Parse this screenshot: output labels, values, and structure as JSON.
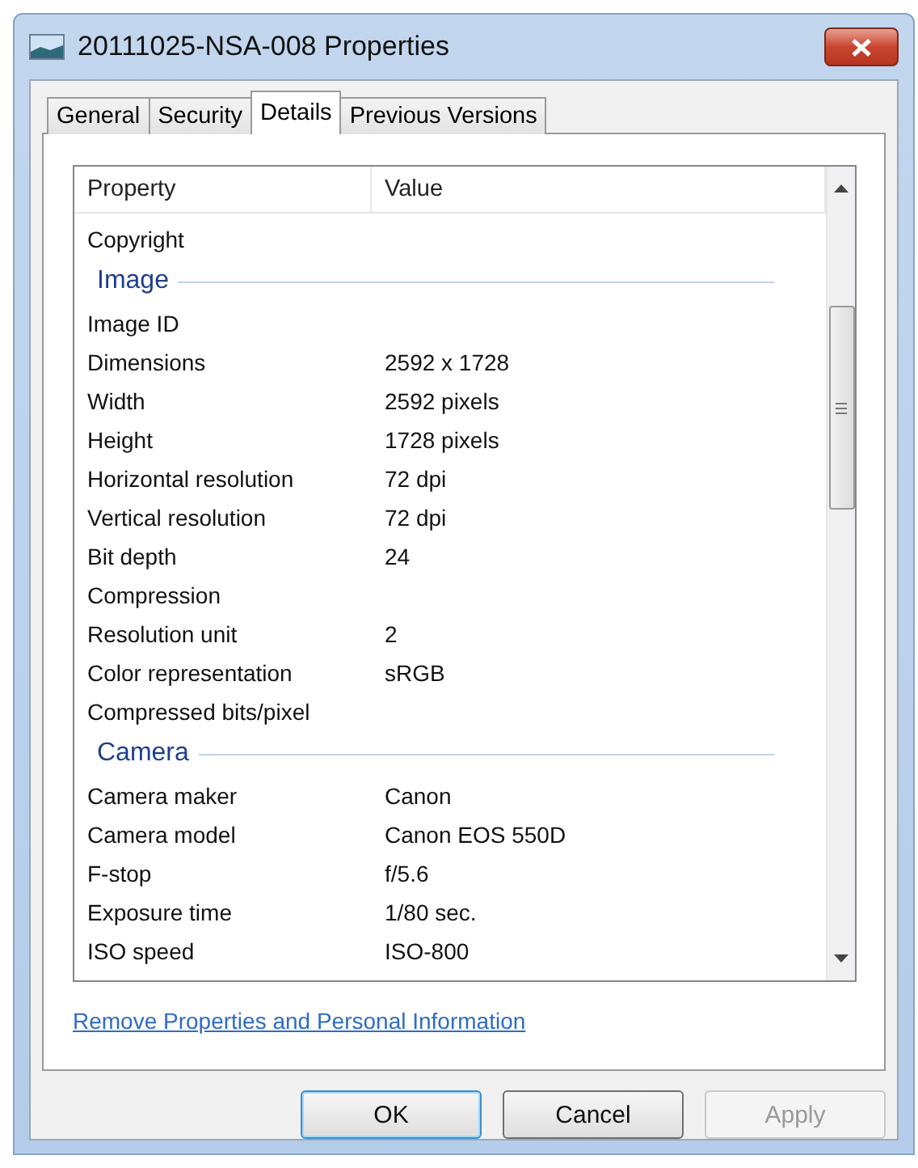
{
  "window": {
    "title": "20111025-NSA-008 Properties"
  },
  "tabs": [
    {
      "label": "General",
      "selected": false
    },
    {
      "label": "Security",
      "selected": false
    },
    {
      "label": "Details",
      "selected": true
    },
    {
      "label": "Previous Versions",
      "selected": false
    }
  ],
  "table": {
    "columns": [
      "Property",
      "Value"
    ],
    "rows": [
      {
        "kind": "row",
        "property": "Copyright"
      },
      {
        "kind": "group",
        "property": "Image"
      },
      {
        "kind": "row",
        "property": "Image ID"
      },
      {
        "kind": "row",
        "property": "Dimensions",
        "value": "2592 x 1728"
      },
      {
        "kind": "row",
        "property": "Width",
        "value": "2592 pixels"
      },
      {
        "kind": "row",
        "property": "Height",
        "value": "1728 pixels"
      },
      {
        "kind": "row",
        "property": "Horizontal resolution",
        "value": "72 dpi"
      },
      {
        "kind": "row",
        "property": "Vertical resolution",
        "value": "72 dpi"
      },
      {
        "kind": "row",
        "property": "Bit depth",
        "value": "24"
      },
      {
        "kind": "row",
        "property": "Compression"
      },
      {
        "kind": "row",
        "property": "Resolution unit",
        "value": "2"
      },
      {
        "kind": "row",
        "property": "Color representation",
        "value": "sRGB"
      },
      {
        "kind": "row",
        "property": "Compressed bits/pixel"
      },
      {
        "kind": "group",
        "property": "Camera"
      },
      {
        "kind": "row",
        "property": "Camera maker",
        "value": "Canon"
      },
      {
        "kind": "row",
        "property": "Camera model",
        "value": "Canon EOS 550D"
      },
      {
        "kind": "row",
        "property": "F-stop",
        "value": "f/5.6"
      },
      {
        "kind": "row",
        "property": "Exposure time",
        "value": "1/80 sec."
      },
      {
        "kind": "row",
        "property": "ISO speed",
        "value": "ISO-800"
      }
    ]
  },
  "link": "Remove Properties and Personal Information",
  "buttons": [
    {
      "label": "OK",
      "default": true,
      "disabled": false
    },
    {
      "label": "Cancel",
      "default": false,
      "disabled": false
    },
    {
      "label": "Apply",
      "default": false,
      "disabled": true
    }
  ]
}
